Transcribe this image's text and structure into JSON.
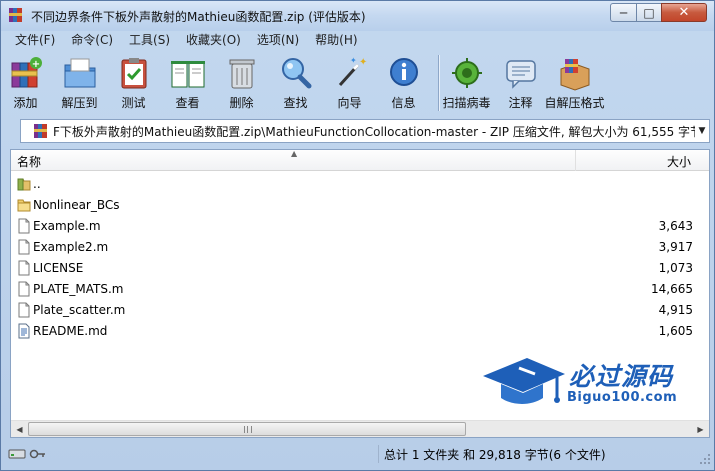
{
  "window": {
    "title": "不同边界条件下板外声散射的Mathieu函数配置.zip (评估版本)"
  },
  "window_buttons": {
    "minimize": "─",
    "maximize": "□",
    "close": "✕"
  },
  "menu": [
    "文件(F)",
    "命令(C)",
    "工具(S)",
    "收藏夹(O)",
    "选项(N)",
    "帮助(H)"
  ],
  "toolbar": [
    {
      "label": "添加",
      "icon": "add-books-icon"
    },
    {
      "label": "解压到",
      "icon": "extract-folder-icon"
    },
    {
      "label": "测试",
      "icon": "test-clipboard-icon"
    },
    {
      "label": "查看",
      "icon": "view-book-icon"
    },
    {
      "label": "删除",
      "icon": "trash-icon"
    },
    {
      "label": "查找",
      "icon": "magnifier-icon"
    },
    {
      "label": "向导",
      "icon": "wizard-wand-icon"
    },
    {
      "label": "信息",
      "icon": "info-icon"
    },
    {
      "label": "扫描病毒",
      "icon": "virus-scan-icon"
    },
    {
      "label": "注释",
      "icon": "comment-icon"
    },
    {
      "label": "自解压格式",
      "icon": "sfx-box-icon"
    }
  ],
  "address": {
    "text": "F下板外声散射的Mathieu函数配置.zip\\MathieuFunctionCollocation-master - ZIP 压缩文件, 解包大小为 61,555 字节"
  },
  "columns": {
    "name": "名称",
    "size": "大小"
  },
  "files": [
    {
      "name": "..",
      "size": "",
      "type": "parent"
    },
    {
      "name": "Nonlinear_BCs",
      "size": "",
      "type": "folder"
    },
    {
      "name": "Example.m",
      "size": "3,643",
      "type": "file"
    },
    {
      "name": "Example2.m",
      "size": "3,917",
      "type": "file"
    },
    {
      "name": "LICENSE",
      "size": "1,073",
      "type": "file"
    },
    {
      "name": "PLATE_MATS.m",
      "size": "14,665",
      "type": "file"
    },
    {
      "name": "Plate_scatter.m",
      "size": "4,915",
      "type": "file"
    },
    {
      "name": "README.md",
      "size": "1,605",
      "type": "doc"
    }
  ],
  "watermark": {
    "title": "必过源码",
    "url": "Biguo100.com"
  },
  "status": {
    "summary": "总计 1 文件夹 和 29,818 字节(6 个文件)"
  },
  "colors": {
    "title_bg": "#c4d8f0",
    "close_btn": "#c75a3e",
    "watermark": "#1e5fb8"
  }
}
